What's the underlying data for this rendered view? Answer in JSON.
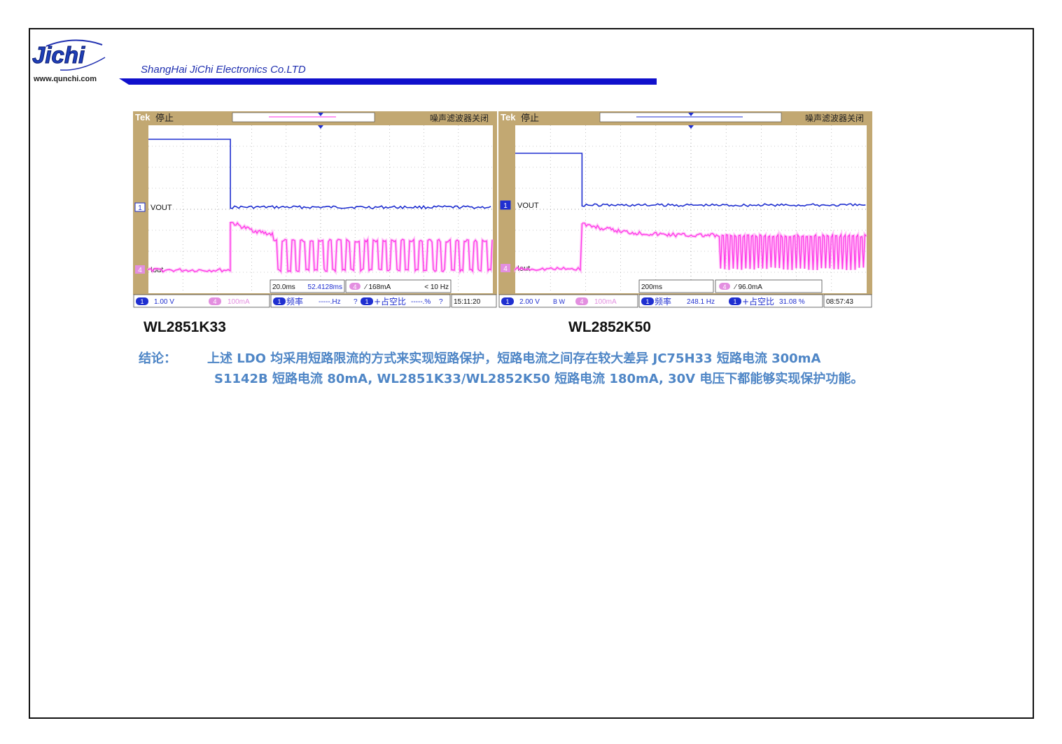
{
  "header": {
    "logo_text": "Jichi",
    "website": "www.qunchi.com",
    "company": "ShangHai JiChi Electronics Co.LTD"
  },
  "scopes": [
    {
      "title": "WL2851K33",
      "status": "停止",
      "brand": "Tek",
      "filter_label": "噪声滤波器关闭",
      "ch1_label": "VOUT",
      "ch4_label": "Iout",
      "ch1_marker": "1",
      "ch4_marker": "4",
      "timebase": "20.0ms",
      "cursor_time": "52.4128ms",
      "trigger": "168mA",
      "trigger_freq": "< 10 Hz",
      "ch1_scale": "1.00 V",
      "ch4_scale": "100mA",
      "freq_label": "频率",
      "freq_value": "-----.Hz",
      "freq_q": "?",
      "duty_label": "+占空比",
      "duty_value": "-----.%",
      "duty_q": "?",
      "bw": "",
      "time": "15:11:20"
    },
    {
      "title": "WL2852K50",
      "status": "停止",
      "brand": "Tek",
      "filter_label": "噪声滤波器关闭",
      "ch1_label": "VOUT",
      "ch4_label": "Iout",
      "ch1_marker": "1",
      "ch4_marker": "4",
      "timebase": "200ms",
      "cursor_time": "",
      "trigger": "96.0mA",
      "trigger_freq": "",
      "ch1_scale": "2.00 V",
      "ch4_scale": "100mA",
      "freq_label": "频率",
      "freq_value": "248.1 Hz",
      "freq_q": "",
      "duty_label": "+占空比",
      "duty_value": "31.08 %",
      "duty_q": "",
      "bw": "B W",
      "time": "08:57:43"
    }
  ],
  "conclusion": {
    "label": "结论：",
    "line1": "上述 LDO 均采用短路限流的方式来实现短路保护，短路电流之间存在较大差异 JC75H33 短路电流 300mA",
    "line2": "S1142B 短路电流 80mA, WL2851K33/WL2852K50 短路电流 180mA, 30V 电压下都能够实现保护功能。"
  },
  "colors": {
    "frame": "#c2a872",
    "ch1": "#1f2fd0",
    "ch4": "#ff2ee6",
    "banner": "#1010cc",
    "conclusion": "#4f86c6"
  }
}
